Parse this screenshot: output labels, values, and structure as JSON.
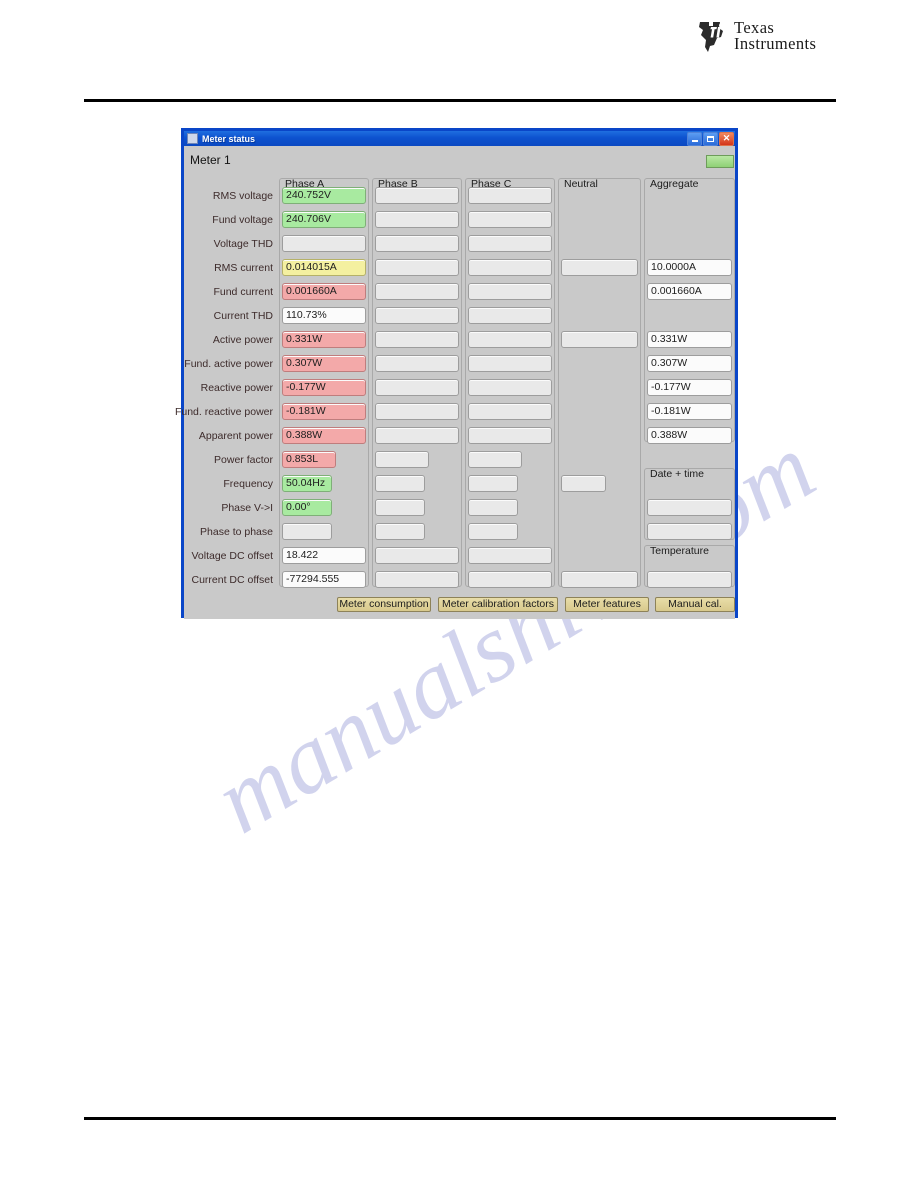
{
  "brand": {
    "line1": "Texas",
    "line2": "Instruments"
  },
  "window": {
    "title": "Meter status",
    "minimize_label": "–",
    "maximize_label": "□",
    "close_label": "✕"
  },
  "panel": {
    "meter_title": "Meter 1",
    "status_led_label": ""
  },
  "columns": [
    {
      "key": "phase_a",
      "title": "Phase A"
    },
    {
      "key": "phase_b",
      "title": "Phase B"
    },
    {
      "key": "phase_c",
      "title": "Phase C"
    },
    {
      "key": "neutral",
      "title": "Neutral"
    },
    {
      "key": "aggregate",
      "title": "Aggregate"
    }
  ],
  "row_labels": [
    "RMS voltage",
    "Fund voltage",
    "Voltage THD",
    "RMS current",
    "Fund current",
    "Current THD",
    "Active power",
    "Fund. active power",
    "Reactive power",
    "Fund. reactive power",
    "Apparent power",
    "Power factor",
    "Frequency",
    "Phase V->I",
    "Phase to phase",
    "Voltage DC offset",
    "Current DC offset"
  ],
  "values": {
    "phase_a": [
      "240.752V",
      "240.706V",
      "",
      "0.014015A",
      "0.001660A",
      "110.73%",
      "0.331W",
      "0.307W",
      "-0.177W",
      "-0.181W",
      "0.388W",
      "0.853L",
      "50.04Hz",
      "0.00°",
      "",
      "18.422",
      "-77294.555"
    ],
    "phase_b": [
      "",
      "",
      "",
      "",
      "",
      "",
      "",
      "",
      "",
      "",
      "",
      "",
      "",
      "",
      "",
      "",
      ""
    ],
    "phase_c": [
      "",
      "",
      "",
      "",
      "",
      "",
      "",
      "",
      "",
      "",
      "",
      "",
      "",
      "",
      "",
      "",
      ""
    ],
    "neutral": [
      "",
      "",
      "",
      "",
      "",
      "",
      "",
      "",
      "",
      "",
      "",
      "",
      "",
      "",
      "",
      "",
      ""
    ],
    "aggregate": [
      "",
      "",
      "",
      "10.0000A",
      "0.001660A",
      "",
      "0.331W",
      "0.307W",
      "-0.177W",
      "-0.181W",
      "0.388W",
      "",
      "",
      "",
      "",
      "",
      ""
    ]
  },
  "aggregate_subgroups": {
    "date_time": {
      "title": "Date + time",
      "values": [
        "",
        ""
      ]
    },
    "temperature": {
      "title": "Temperature",
      "values": [
        ""
      ]
    }
  },
  "buttons": [
    "Meter consumption",
    "Meter calibration factors",
    "Meter features",
    "Manual cal."
  ],
  "watermark": {
    "text": "manualshive.com"
  },
  "colors": {
    "accent_blue": "#0a46c8",
    "dialog_face": "#c9c9c9",
    "field_green": "#a8eaa0",
    "field_yellow": "#f4f0a0",
    "field_red": "#f3a9a9",
    "field_white": "#fbfbfb",
    "button_tan": "#e0d29a"
  }
}
